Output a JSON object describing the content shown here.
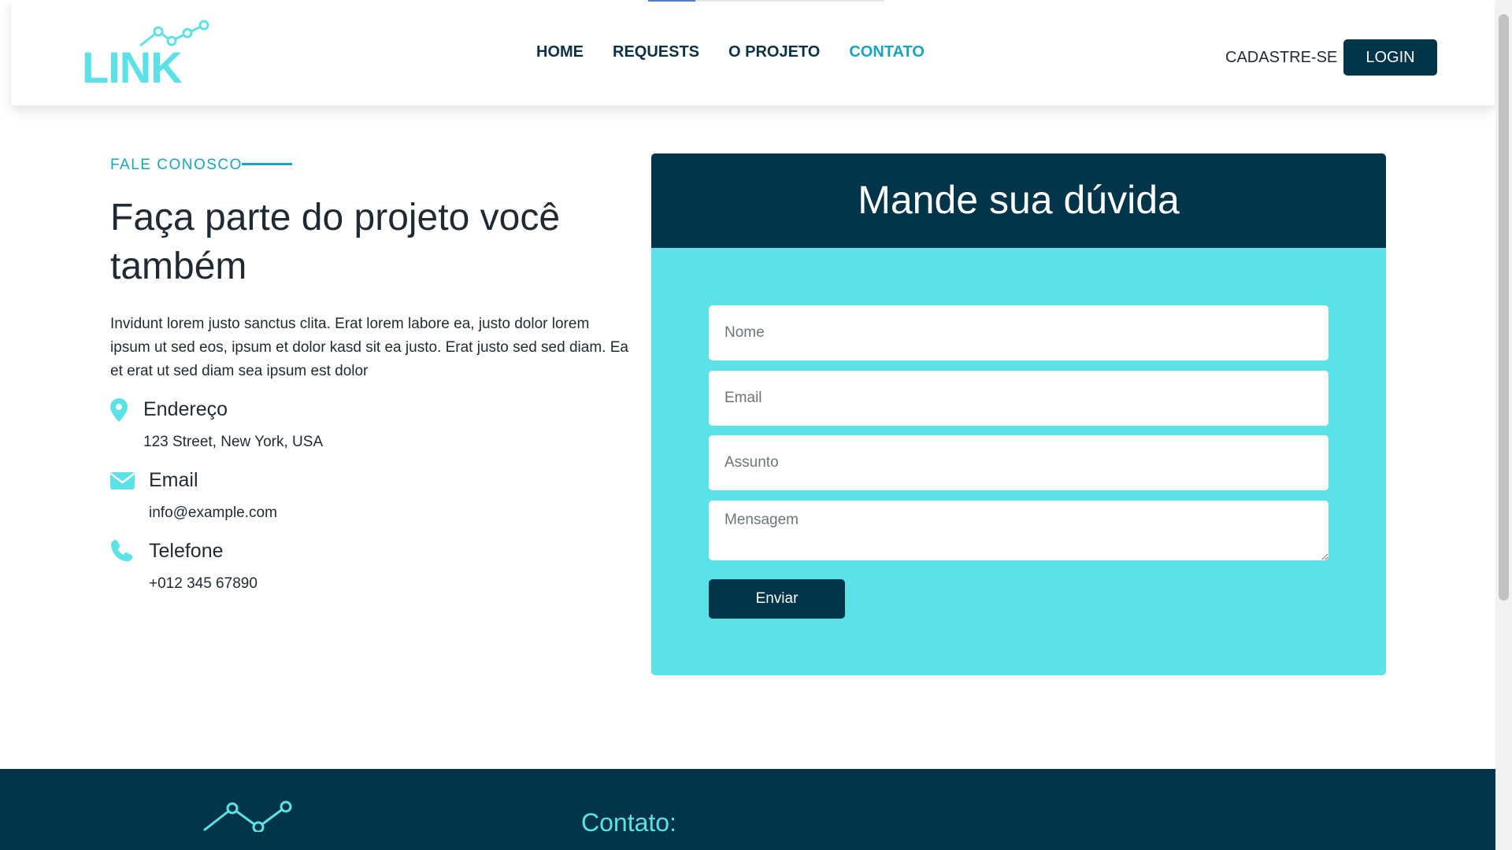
{
  "header": {
    "logo_text": "LINK",
    "nav": [
      {
        "label": "HOME"
      },
      {
        "label": "REQUESTS"
      },
      {
        "label": "O PROJETO"
      },
      {
        "label": "CONTATO"
      }
    ],
    "signup_label": "CADASTRE-SE",
    "login_label": "LOGIN"
  },
  "contact": {
    "eyebrow": "FALE CONOSCO",
    "headline": "Faça parte do projeto você também",
    "description": "Invidunt lorem justo sanctus clita. Erat lorem labore ea, justo dolor lorem ipsum ut sed eos, ipsum et dolor kasd sit ea justo. Erat justo sed sed diam. Ea et erat ut sed diam sea ipsum est dolor",
    "address": {
      "title": "Endereço",
      "value": "123 Street, New York, USA",
      "icon": "map-marker-icon"
    },
    "email": {
      "title": "Email",
      "value": "info@example.com",
      "icon": "envelope-icon"
    },
    "phone": {
      "title": "Telefone",
      "value": "+012 345 67890",
      "icon": "phone-icon"
    }
  },
  "form": {
    "title": "Mande sua dúvida",
    "name_placeholder": "Nome",
    "email_placeholder": "Email",
    "subject_placeholder": "Assunto",
    "message_placeholder": "Mensagem",
    "submit_label": "Enviar"
  },
  "footer": {
    "contact_heading": "Contato:"
  },
  "colors": {
    "primary_dark": "#02344a",
    "accent_cyan": "#5ce1e6",
    "link_active": "#1aa3bf"
  }
}
